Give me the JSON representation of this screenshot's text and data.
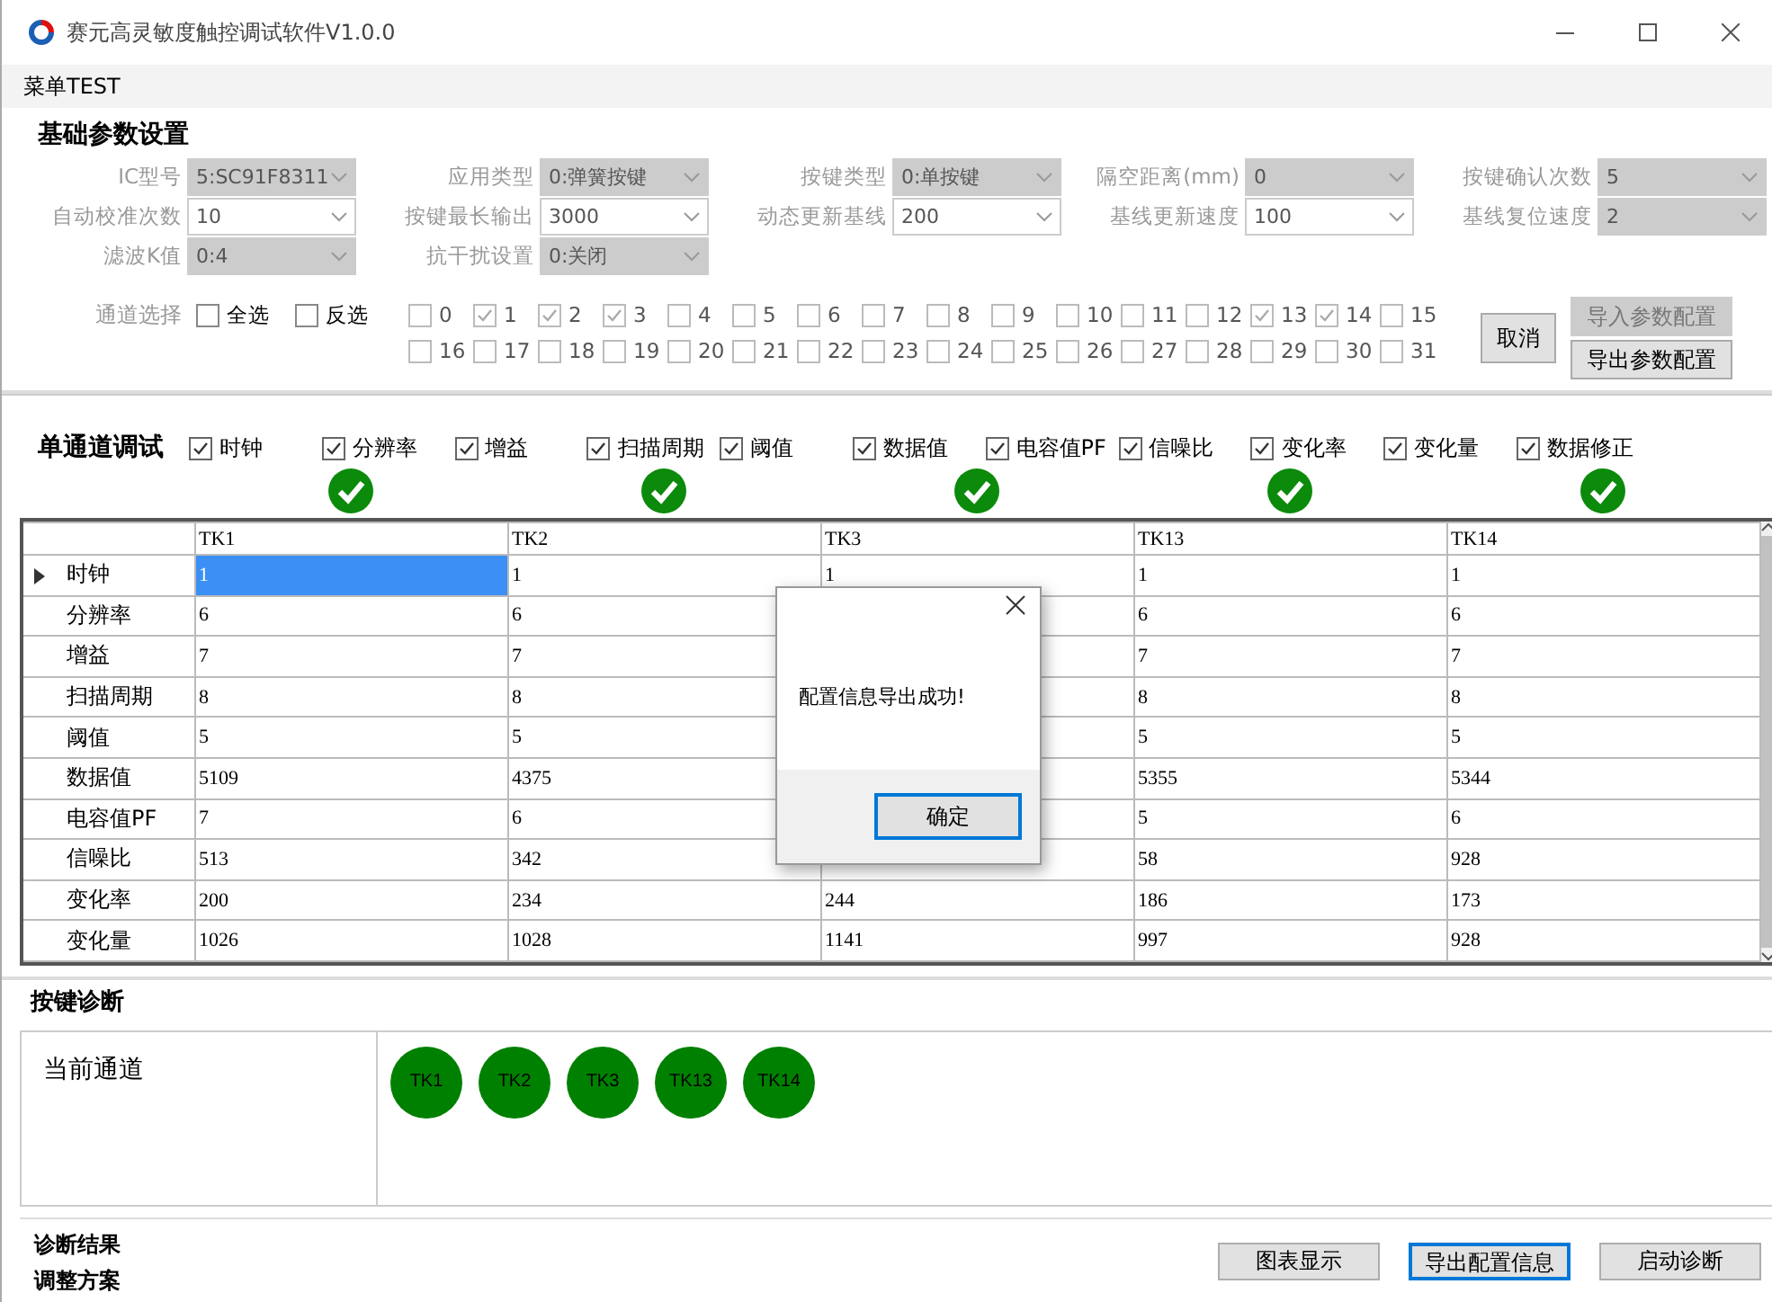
{
  "window": {
    "title": "赛元高灵敏度触控调试软件V1.0.0"
  },
  "menu": [
    {
      "label": "菜单TEST"
    }
  ],
  "basic_params": {
    "title": "基础参数设置",
    "fields": [
      {
        "label": "IC型号",
        "value": "5:SC91F8311",
        "disabled": true
      },
      {
        "label": "应用类型",
        "value": "0:弹簧按键",
        "disabled": true
      },
      {
        "label": "按键类型",
        "value": "0:单按键",
        "disabled": true
      },
      {
        "label": "隔空距离(mm)",
        "value": "0",
        "disabled": true
      },
      {
        "label": "按键确认次数",
        "value": "5",
        "disabled": true
      },
      {
        "label": "自动校准次数",
        "value": "10",
        "disabled": false
      },
      {
        "label": "按键最长输出",
        "value": "3000",
        "disabled": false
      },
      {
        "label": "动态更新基线",
        "value": "200",
        "disabled": false
      },
      {
        "label": "基线更新速度",
        "value": "100",
        "disabled": false
      },
      {
        "label": "基线复位速度",
        "value": "2",
        "disabled": true
      },
      {
        "label": "滤波K值",
        "value": "0:4",
        "disabled": true
      },
      {
        "label": "抗干扰设置",
        "value": "0:关闭",
        "disabled": true
      }
    ],
    "channel_select": {
      "label": "通道选择",
      "options": [
        {
          "label": "全选",
          "checked": false
        },
        {
          "label": "反选",
          "checked": false
        }
      ],
      "channels": [
        {
          "label": "0",
          "checked": false
        },
        {
          "label": "1",
          "checked": true
        },
        {
          "label": "2",
          "checked": true
        },
        {
          "label": "3",
          "checked": true
        },
        {
          "label": "4",
          "checked": false
        },
        {
          "label": "5",
          "checked": false
        },
        {
          "label": "6",
          "checked": false
        },
        {
          "label": "7",
          "checked": false
        },
        {
          "label": "8",
          "checked": false
        },
        {
          "label": "9",
          "checked": false
        },
        {
          "label": "10",
          "checked": false
        },
        {
          "label": "11",
          "checked": false
        },
        {
          "label": "12",
          "checked": false
        },
        {
          "label": "13",
          "checked": true
        },
        {
          "label": "14",
          "checked": true
        },
        {
          "label": "15",
          "checked": false
        },
        {
          "label": "16",
          "checked": false
        },
        {
          "label": "17",
          "checked": false
        },
        {
          "label": "18",
          "checked": false
        },
        {
          "label": "19",
          "checked": false
        },
        {
          "label": "20",
          "checked": false
        },
        {
          "label": "21",
          "checked": false
        },
        {
          "label": "22",
          "checked": false
        },
        {
          "label": "23",
          "checked": false
        },
        {
          "label": "24",
          "checked": false
        },
        {
          "label": "25",
          "checked": false
        },
        {
          "label": "26",
          "checked": false
        },
        {
          "label": "27",
          "checked": false
        },
        {
          "label": "28",
          "checked": false
        },
        {
          "label": "29",
          "checked": false
        },
        {
          "label": "30",
          "checked": false
        },
        {
          "label": "31",
          "checked": false
        }
      ]
    },
    "cancel_button": {
      "label": "取消"
    },
    "buttons": [
      {
        "label": "导入参数配置",
        "disabled": true
      },
      {
        "label": "导出参数配置",
        "disabled": false
      }
    ]
  },
  "single_channel": {
    "title": "单通道调试",
    "options": [
      {
        "label": "时钟",
        "checked": true
      },
      {
        "label": "分辨率",
        "checked": true
      },
      {
        "label": "增益",
        "checked": true
      },
      {
        "label": "扫描周期",
        "checked": true
      },
      {
        "label": "阈值",
        "checked": true
      },
      {
        "label": "数据值",
        "checked": true
      },
      {
        "label": "电容值PF",
        "checked": true
      },
      {
        "label": "信噪比",
        "checked": true
      },
      {
        "label": "变化率",
        "checked": true
      },
      {
        "label": "变化量",
        "checked": true
      },
      {
        "label": "数据修正",
        "checked": true
      }
    ]
  },
  "table": {
    "columns": [
      {
        "label": "TK1",
        "ok": true
      },
      {
        "label": "TK2",
        "ok": true
      },
      {
        "label": "TK3",
        "ok": true
      },
      {
        "label": "TK13",
        "ok": true
      },
      {
        "label": "TK14",
        "ok": true
      }
    ],
    "rows": [
      {
        "label": "时钟",
        "current": true,
        "cells": [
          {
            "text": "1",
            "selected": true
          },
          {
            "text": "1",
            "selected": false
          },
          {
            "text": "1",
            "selected": false
          },
          {
            "text": "1",
            "selected": false
          },
          {
            "text": "1",
            "selected": false
          }
        ]
      },
      {
        "label": "分辨率",
        "current": false,
        "cells": [
          {
            "text": "6",
            "selected": false
          },
          {
            "text": "6",
            "selected": false
          },
          null,
          {
            "text": "6",
            "selected": false
          },
          {
            "text": "6",
            "selected": false
          }
        ]
      },
      {
        "label": "增益",
        "current": false,
        "cells": [
          {
            "text": "7",
            "selected": false
          },
          {
            "text": "7",
            "selected": false
          },
          null,
          {
            "text": "7",
            "selected": false
          },
          {
            "text": "7",
            "selected": false
          }
        ]
      },
      {
        "label": "扫描周期",
        "current": false,
        "cells": [
          {
            "text": "8",
            "selected": false
          },
          {
            "text": "8",
            "selected": false
          },
          null,
          {
            "text": "8",
            "selected": false
          },
          {
            "text": "8",
            "selected": false
          }
        ]
      },
      {
        "label": "阈值",
        "current": false,
        "cells": [
          {
            "text": "5",
            "selected": false
          },
          {
            "text": "5",
            "selected": false
          },
          null,
          {
            "text": "5",
            "selected": false
          },
          {
            "text": "5",
            "selected": false
          }
        ]
      },
      {
        "label": "数据值",
        "current": false,
        "cells": [
          {
            "text": "5109",
            "selected": false
          },
          {
            "text": "4375",
            "selected": false
          },
          null,
          {
            "text": "5355",
            "selected": false
          },
          {
            "text": "5344",
            "selected": false
          }
        ]
      },
      {
        "label": "电容值PF",
        "current": false,
        "cells": [
          {
            "text": "7",
            "selected": false
          },
          {
            "text": "6",
            "selected": false
          },
          null,
          {
            "text": "5",
            "selected": false
          },
          {
            "text": "6",
            "selected": false
          }
        ]
      },
      {
        "label": "信噪比",
        "current": false,
        "cells": [
          {
            "text": "513",
            "selected": false
          },
          {
            "text": "342",
            "selected": false
          },
          null,
          {
            "text": "58",
            "selected": false
          },
          {
            "text": "928",
            "selected": false
          }
        ]
      },
      {
        "label": "变化率",
        "current": false,
        "cells": [
          {
            "text": "200",
            "selected": false
          },
          {
            "text": "234",
            "selected": false
          },
          {
            "text": "244",
            "selected": false
          },
          {
            "text": "186",
            "selected": false
          },
          {
            "text": "173",
            "selected": false
          }
        ]
      },
      {
        "label": "变化量",
        "current": false,
        "cells": [
          {
            "text": "1026",
            "selected": false
          },
          {
            "text": "1028",
            "selected": false
          },
          {
            "text": "1141",
            "selected": false
          },
          {
            "text": "997",
            "selected": false
          },
          {
            "text": "928",
            "selected": false
          }
        ]
      }
    ]
  },
  "dialog": {
    "message": "配置信息导出成功!",
    "button": "确定"
  },
  "diagnosis": {
    "title": "按键诊断",
    "current_label": "当前通道",
    "channels": [
      {
        "label": "TK1"
      },
      {
        "label": "TK2"
      },
      {
        "label": "TK3"
      },
      {
        "label": "TK13"
      },
      {
        "label": "TK14"
      }
    ]
  },
  "footer": {
    "labels": [
      "诊断结果",
      "调整方案"
    ],
    "buttons": [
      {
        "label": "图表显示",
        "focused": false
      },
      {
        "label": "导出配置信息",
        "focused": true
      },
      {
        "label": "启动诊断",
        "focused": false
      }
    ]
  }
}
